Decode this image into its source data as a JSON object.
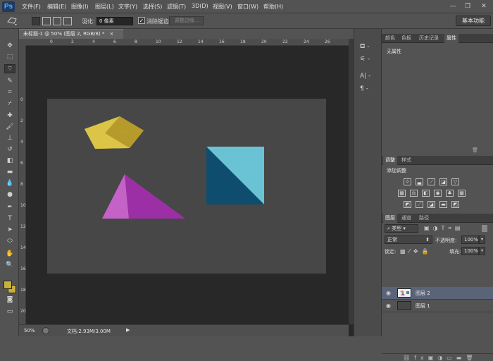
{
  "app": {
    "logo": "Ps"
  },
  "menu": [
    "文件(F)",
    "编辑(E)",
    "图像(I)",
    "图层(L)",
    "文字(Y)",
    "选择(S)",
    "滤镜(T)",
    "3D(D)",
    "视图(V)",
    "窗口(W)",
    "帮助(H)"
  ],
  "window_controls": {
    "minimize": "—",
    "restore": "❐",
    "close": "✕"
  },
  "options": {
    "feather_label": "羽化:",
    "feather_value": "0 像素",
    "antialias_label": "消除锯齿",
    "antialias_checked": true,
    "refine_edge": "调整边缘...",
    "workspace": "基本功能"
  },
  "document": {
    "tab_title": "未标题-1 @ 50% (图层 2, RGB/8) *",
    "tab_close": "×",
    "zoom": "50%",
    "doc_info": "文档:2.93M/3.00M",
    "ruler_top": [
      "0",
      "2",
      "4",
      "6",
      "8",
      "10",
      "12",
      "14",
      "16",
      "18",
      "20",
      "22",
      "24",
      "26",
      "28"
    ],
    "ruler_left": [
      "0",
      "2",
      "4",
      "6",
      "8",
      "10",
      "12",
      "14",
      "16",
      "18",
      "20",
      "22",
      "24"
    ]
  },
  "panels": {
    "top_tabs": [
      "颜色",
      "色板",
      "历史记录",
      "属性"
    ],
    "top_active": "属性",
    "properties_text": "无属性",
    "adjust_tabs": [
      "调整",
      "样式"
    ],
    "adjust_title": "添加调整",
    "layers_tabs": [
      "图层",
      "通道",
      "路径"
    ],
    "filter_kind": "类型",
    "blend_mode": "正常",
    "opacity_label": "不透明度:",
    "opacity_value": "100%",
    "lock_label": "锁定:",
    "fill_label": "填充:",
    "fill_value": "100%",
    "layers": [
      {
        "name": "图层 2",
        "selected": true
      },
      {
        "name": "图层 1",
        "selected": false
      }
    ]
  },
  "colors": {
    "pentagon_light": "#dcc447",
    "pentagon_dark": "#b69a2c",
    "triangle_light": "#c462c8",
    "triangle_dark": "#9d2fa6",
    "square_light": "#6ac3d4",
    "square_dark": "#0e4d6d"
  }
}
